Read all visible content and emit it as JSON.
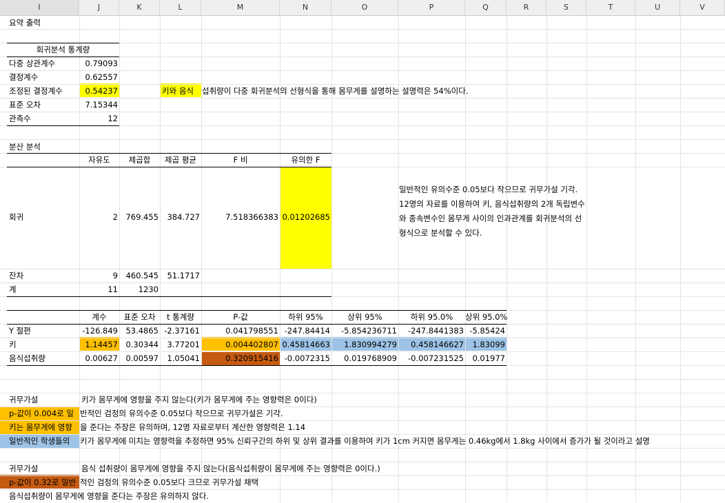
{
  "columns": [
    "I",
    "J",
    "K",
    "L",
    "M",
    "N",
    "O",
    "P",
    "Q",
    "R",
    "S",
    "T",
    "U",
    "V"
  ],
  "colors": {
    "yellow": "#ffff00",
    "orange": "#ffc000",
    "rust": "#c55a11",
    "blue": "#9dc3e6"
  },
  "summary": {
    "title": "요약 출력",
    "regstats_title": "회귀분석 통계량",
    "rows": [
      {
        "label": "다중 상관계수",
        "value": "0.79093"
      },
      {
        "label": "결정계수",
        "value": "0.62557"
      },
      {
        "label": "조정된 결정계수",
        "value": "0.54237"
      },
      {
        "label": "표준 오차",
        "value": "7.15344"
      },
      {
        "label": "관측수",
        "value": "12"
      }
    ],
    "adj_note_hl": "키와 음식",
    "adj_note_rest": "섭취량이 다중 회귀분석의 선형식을 통해 몸무게를 설명하는 설명력은 54%이다."
  },
  "anova": {
    "title": "분산 분석",
    "headers": [
      "자유도",
      "제곱합",
      "제곱 평균",
      "F 비",
      "유의한 F"
    ],
    "rows": [
      {
        "label": "회귀",
        "df": "2",
        "ss": "769.455",
        "ms": "384.727",
        "f": "7.518366383",
        "sig": "0.01202685"
      },
      {
        "label": "잔차",
        "df": "9",
        "ss": "460.545",
        "ms": "51.1717",
        "f": "",
        "sig": ""
      },
      {
        "label": "계",
        "df": "11",
        "ss": "1230",
        "ms": "",
        "f": "",
        "sig": ""
      }
    ],
    "note": "일반적인 유의수준 0.05보다 작으므로 귀무가설 기각. 12명의 자료를 이용하여 키, 음식섭취량의 2개 독립변수와 종속변수인 몸무게 사이의 인과관계를 회귀분석의 선형식으로 분석할 수 있다."
  },
  "coef": {
    "headers": [
      "계수",
      "표준 오차",
      "t 통계량",
      "P-값",
      "하위 95%",
      "상위 95%",
      "하위 95.0%",
      "상위 95.0%"
    ],
    "rows": [
      {
        "label": "Y 절편",
        "v": [
          "-126.849",
          "53.4865",
          "-2.37161",
          "0.041798551",
          "-247.84414",
          "-5.854236711",
          "-247.8441383",
          "-5.85424"
        ]
      },
      {
        "label": "키",
        "v": [
          "1.14457",
          "0.30344",
          "3.77201",
          "0.004402807",
          "0.45814663",
          "1.830994279",
          "0.458146627",
          "1.83099"
        ]
      },
      {
        "label": "음식섭취량",
        "v": [
          "0.00627",
          "0.00597",
          "1.05041",
          "0.320915416",
          "-0.0072315",
          "0.019768909",
          "-0.007231525",
          "0.01977"
        ]
      }
    ]
  },
  "notes1": {
    "h0_label": "귀무가설",
    "h0_text": "키가 몸무게에 영향을 주지 않는다(키가 몸무게에 주는 영향력은 0이다)",
    "line1_hl": "p-값이 0.004로 일",
    "line1_rest": "반적인 검정의 유의수준 0.05보다 작으므로 귀무가설은 기각.",
    "line2_hl": "키는 몸무게에 영향",
    "line2_rest": "을 준다는 주장은 유의하며, 12명 자료로부터 계산한 영향력은 1.14",
    "line3_hl": "일반적인 학생들의",
    "line3_rest": "키가 몸무게에 미치는 영향력을 추정하면 95% 신뢰구간의 하위 및 상위 결과를 이용하여 키가 1cm 커지면 몸무게는  0.46kg에서 1.8kg 사이에서 증가가 될 것이라고 설명"
  },
  "notes2": {
    "h0_label": "귀무가설",
    "h0_text": "음식 섭취량이 몸무게에 영향을 주지 않는다(음식섭취량이 몸무게에 주는 영향력은 0이다.)",
    "line1_hl": "p-값이 0.32로 일반",
    "line1_rest": "적인 검정의 유의수준 0.05보다 크므로 귀무가설 채택",
    "line2": "음식섭취량이 몸무게에 영향을 준다는 주장은 유의하지 않다."
  }
}
